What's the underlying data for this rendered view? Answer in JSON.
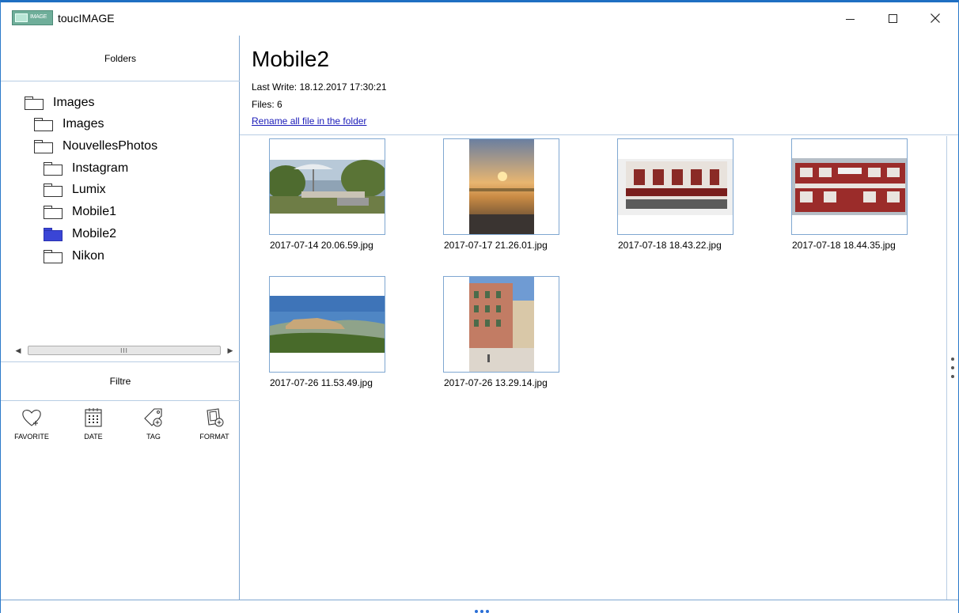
{
  "window": {
    "title": "toucIMAGE",
    "logo_text": "IMAGE"
  },
  "left_panel": {
    "folders_header": "Folders",
    "tree": [
      {
        "label": "Images"
      },
      {
        "label": "Images"
      },
      {
        "label": "NouvellesPhotos"
      },
      {
        "label": "Instagram"
      },
      {
        "label": "Lumix"
      },
      {
        "label": "Mobile1"
      },
      {
        "label": "Mobile2",
        "selected": true
      },
      {
        "label": "Nikon"
      }
    ],
    "scroll_thumb_grip": "III",
    "filter_header": "Filtre",
    "filters": [
      {
        "label": "FAVORITE",
        "icon": "heart-plus-icon"
      },
      {
        "label": "DATE",
        "icon": "calendar-icon"
      },
      {
        "label": "TAG",
        "icon": "tag-plus-icon"
      },
      {
        "label": "FORMAT",
        "icon": "format-plus-icon"
      }
    ]
  },
  "main": {
    "folder_name": "Mobile2",
    "last_write": "Last Write: 18.12.2017 17:30:21",
    "files": "Files: 6",
    "rename_link": "Rename all file in the folder",
    "images": [
      {
        "filename": "2017-07-14 20.06.59.jpg",
        "scene": "garden terrace with parasol"
      },
      {
        "filename": "2017-07-17 21.26.01.jpg",
        "scene": "sunset over sea"
      },
      {
        "filename": "2017-07-18 18.43.22.jpg",
        "scene": "red timbered building"
      },
      {
        "filename": "2017-07-18 18.44.35.jpg",
        "scene": "red timbered building"
      },
      {
        "filename": "2017-07-26 11.53.49.jpg",
        "scene": "hilltop village landscape"
      },
      {
        "filename": "2017-07-26 13.29.14.jpg",
        "scene": "pink building on square"
      }
    ]
  },
  "colors": {
    "accent": "#1f6fc2",
    "selected_folder": "#3a45d6",
    "link": "#1a1ab8"
  }
}
